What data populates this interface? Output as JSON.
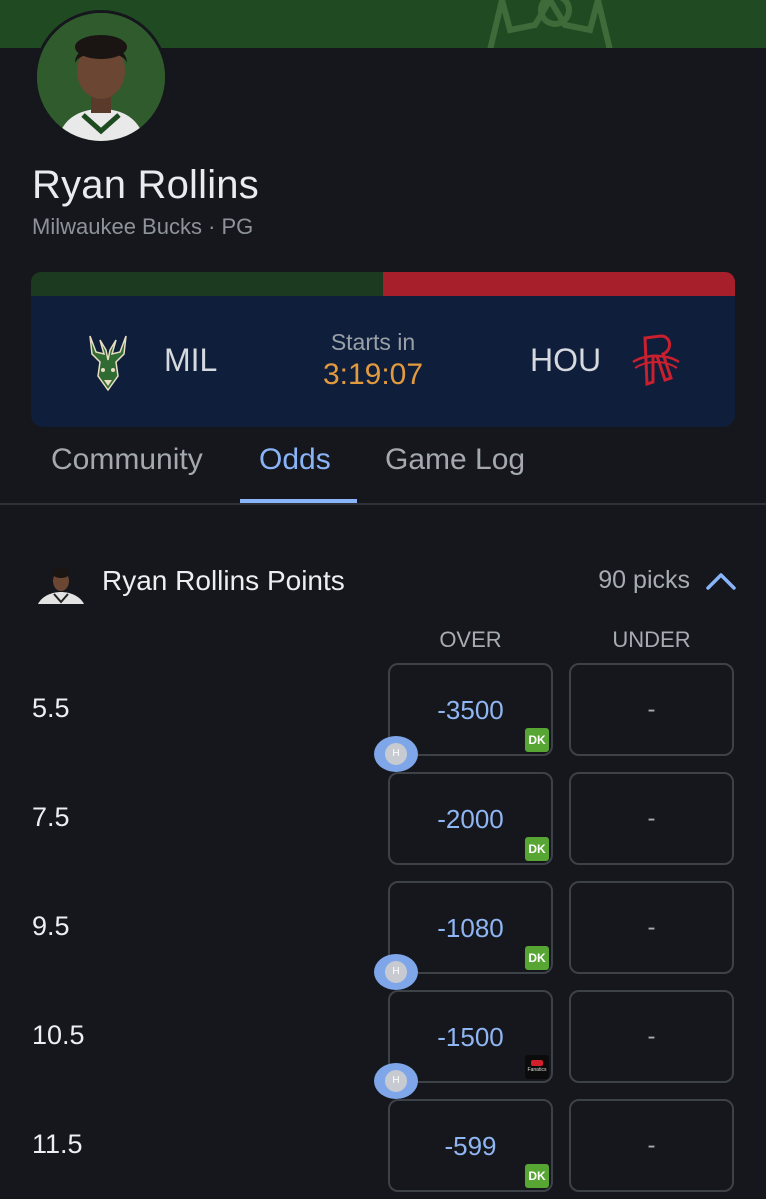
{
  "player": {
    "name": "Ryan Rollins",
    "meta": "Milwaukee Bucks · PG"
  },
  "colors": {
    "home_team": "#1c3a1f",
    "away_team": "#a61f2b",
    "accent": "#8ab4f8",
    "countdown": "#e39a3f",
    "draftkings": "#57a532"
  },
  "matchup": {
    "home_abbr": "MIL",
    "away_abbr": "HOU",
    "home_logo_icon": "bucks-logo-icon",
    "away_logo_icon": "rockets-logo-icon",
    "starts_label": "Starts in",
    "countdown": "3:19:07"
  },
  "tabs": [
    {
      "label": "Community",
      "active": false
    },
    {
      "label": "Odds",
      "active": true
    },
    {
      "label": "Game Log",
      "active": false
    }
  ],
  "market": {
    "title": "Ryan Rollins Points",
    "picks": "90 picks",
    "expanded": true,
    "columns": {
      "over": "OVER",
      "under": "UNDER"
    },
    "rows": [
      {
        "line": "5.5",
        "over": "-3500",
        "under": "-",
        "book": "DK",
        "h_badge": "H"
      },
      {
        "line": "7.5",
        "over": "-2000",
        "under": "-",
        "book": "DK",
        "h_badge": null
      },
      {
        "line": "9.5",
        "over": "-1080",
        "under": "-",
        "book": "DK",
        "h_badge": "H"
      },
      {
        "line": "10.5",
        "over": "-1500",
        "under": "-",
        "book": "Fanatics",
        "book_text": "Fanatics",
        "h_badge": "H"
      },
      {
        "line": "11.5",
        "over": "-599",
        "under": "-",
        "book": "DK",
        "h_badge": null
      }
    ]
  }
}
